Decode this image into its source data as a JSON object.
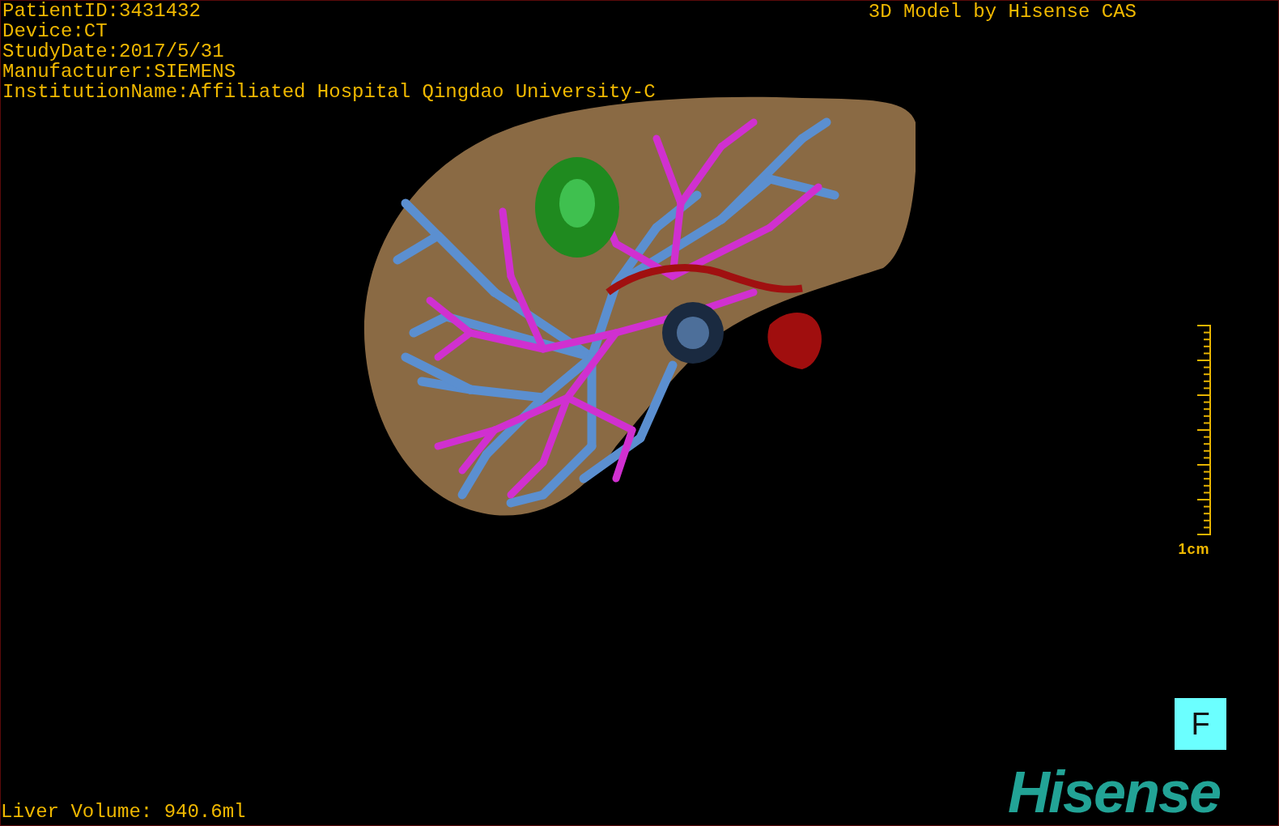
{
  "patient_info": [
    "PatientID:3431432",
    "Device:CT",
    "StudyDate:2017/5/31",
    "Manufacturer:SIEMENS",
    "InstitutionName:Affiliated Hospital Qingdao University-C"
  ],
  "title": "3D Model by Hisense CAS",
  "scale_bar": {
    "label": "1cm"
  },
  "orientation_marker": "F",
  "liver_volume": "Liver Volume: 940.6ml",
  "logo": "Hisense"
}
